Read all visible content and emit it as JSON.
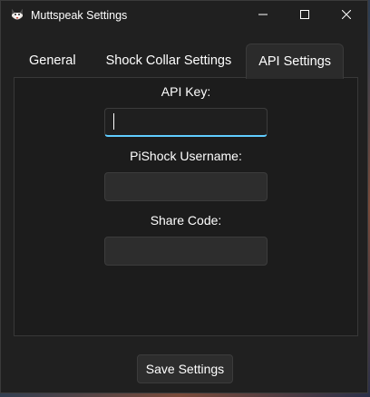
{
  "window": {
    "title": "Muttspeak Settings",
    "app_icon": "husky-icon",
    "controls": [
      "minimize-icon",
      "maximize-icon",
      "close-icon"
    ]
  },
  "tabs": [
    {
      "label": "General",
      "active": false
    },
    {
      "label": "Shock Collar Settings",
      "active": false
    },
    {
      "label": "API Settings",
      "active": true
    }
  ],
  "api_settings": {
    "api_key_label": "API Key:",
    "api_key_value": "",
    "username_label": "PiShock Username:",
    "username_value": "",
    "share_code_label": "Share Code:",
    "share_code_value": ""
  },
  "footer": {
    "save_label": "Save Settings"
  },
  "colors": {
    "window_bg": "#202020",
    "accent": "#60cdff"
  }
}
